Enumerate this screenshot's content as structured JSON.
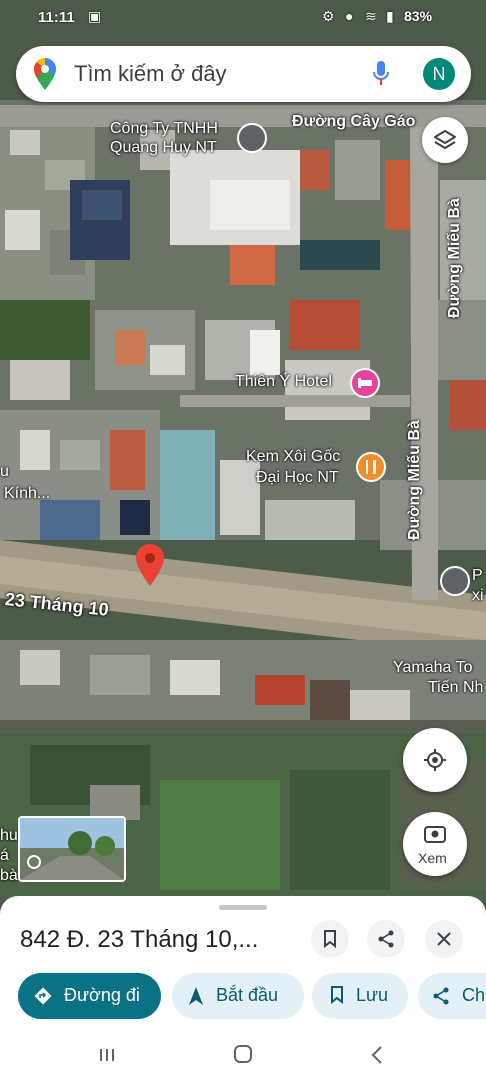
{
  "status_bar": {
    "time": "11:11",
    "battery": "83%"
  },
  "search": {
    "placeholder": "Tìm kiếm ở đây",
    "avatar_letter": "N"
  },
  "map": {
    "streets": [
      {
        "name": "Đường Cây Gáo"
      },
      {
        "name": "Đường Miếu Bà"
      },
      {
        "name": "Đường Miếu Bà"
      },
      {
        "name": "23 Tháng 10"
      }
    ],
    "places": [
      {
        "name_line1": "Công Ty TNHH",
        "name_line2": "Quang Huy NT",
        "icon": "location-pin-icon"
      },
      {
        "name_line1": "Thiên Ý Hotel",
        "icon": "hotel-bed-icon"
      },
      {
        "name_line1": "Kem Xôi Gốc",
        "name_line2": "Đại Học NT",
        "icon": "food-icon"
      },
      {
        "name_line1": "Yamaha To",
        "name_line2": "Tiến Nh"
      },
      {
        "name_line1": "P",
        "name_line2": "xi",
        "icon": "location-pin-icon"
      }
    ],
    "edge_fragments": [
      "u",
      "Kính...",
      "hu",
      "á",
      "bà"
    ]
  },
  "controls": {
    "street_view_label": "Xem"
  },
  "bottom_sheet": {
    "address": "842 Đ. 23 Tháng 10,...",
    "chips": [
      {
        "label": "Đường đi",
        "icon": "directions-icon"
      },
      {
        "label": "Bắt đầu",
        "icon": "navigation-arrow-icon"
      },
      {
        "label": "Lưu",
        "icon": "bookmark-icon"
      },
      {
        "label": "Ch",
        "icon": "share-icon"
      }
    ]
  }
}
